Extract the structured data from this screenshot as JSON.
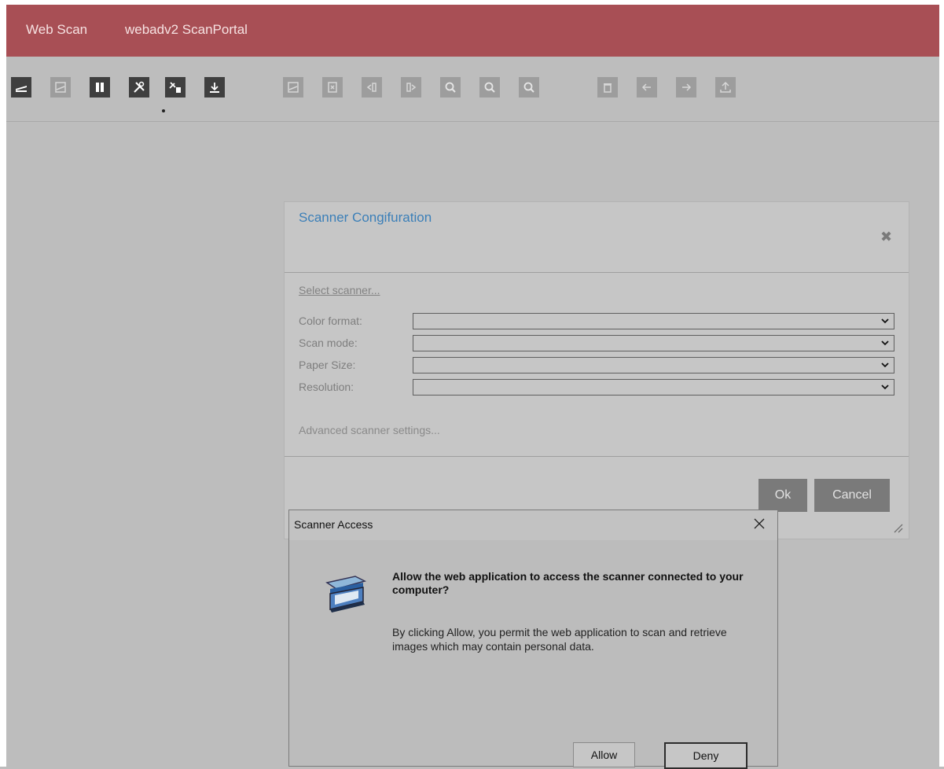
{
  "header": {
    "brand": "Web Scan",
    "portal": "webadv2 ScanPortal"
  },
  "toolbar": {
    "buttons": [
      {
        "name": "scan",
        "icon": "scanner-icon"
      },
      {
        "name": "scan-preview",
        "icon": "scan-preview-icon"
      },
      {
        "name": "pause",
        "icon": "pause-icon"
      },
      {
        "name": "scanner-settings",
        "icon": "tools-icon"
      },
      {
        "name": "settings-clear",
        "icon": "tools-delete-icon"
      },
      {
        "name": "download",
        "icon": "download-icon"
      },
      {
        "name": "rescan",
        "icon": "rescan-icon"
      },
      {
        "name": "delete-page",
        "icon": "delete-page-icon"
      },
      {
        "name": "rotate-left",
        "icon": "rotate-left-icon"
      },
      {
        "name": "rotate-right",
        "icon": "rotate-right-icon"
      },
      {
        "name": "zoom-in",
        "icon": "zoom-in-icon"
      },
      {
        "name": "zoom-out",
        "icon": "zoom-out-icon"
      },
      {
        "name": "zoom-fit",
        "icon": "zoom-icon"
      },
      {
        "name": "delete-all",
        "icon": "trash-icon"
      },
      {
        "name": "previous",
        "icon": "arrow-left-icon"
      },
      {
        "name": "next",
        "icon": "arrow-right-icon"
      },
      {
        "name": "upload",
        "icon": "upload-icon"
      }
    ]
  },
  "config_dialog": {
    "title": "Scanner Congifuration",
    "select_scanner": "Select scanner...",
    "fields": [
      {
        "label": "Color format:",
        "value": ""
      },
      {
        "label": "Scan mode:",
        "value": ""
      },
      {
        "label": "Paper Size:",
        "value": ""
      },
      {
        "label": "Resolution:",
        "value": ""
      }
    ],
    "advanced": "Advanced scanner settings...",
    "ok": "Ok",
    "cancel": "Cancel"
  },
  "access_dialog": {
    "title": "Scanner Access",
    "heading": "Allow the web application to access the scanner connected to your computer?",
    "body": "By clicking Allow, you permit the web application to scan and retrieve images which may contain personal data.",
    "allow": "Allow",
    "deny": "Deny"
  },
  "colors": {
    "header_bg": "#a84f55",
    "title_blue": "#3b7fb8",
    "active_tool": "#3f3f3f"
  }
}
